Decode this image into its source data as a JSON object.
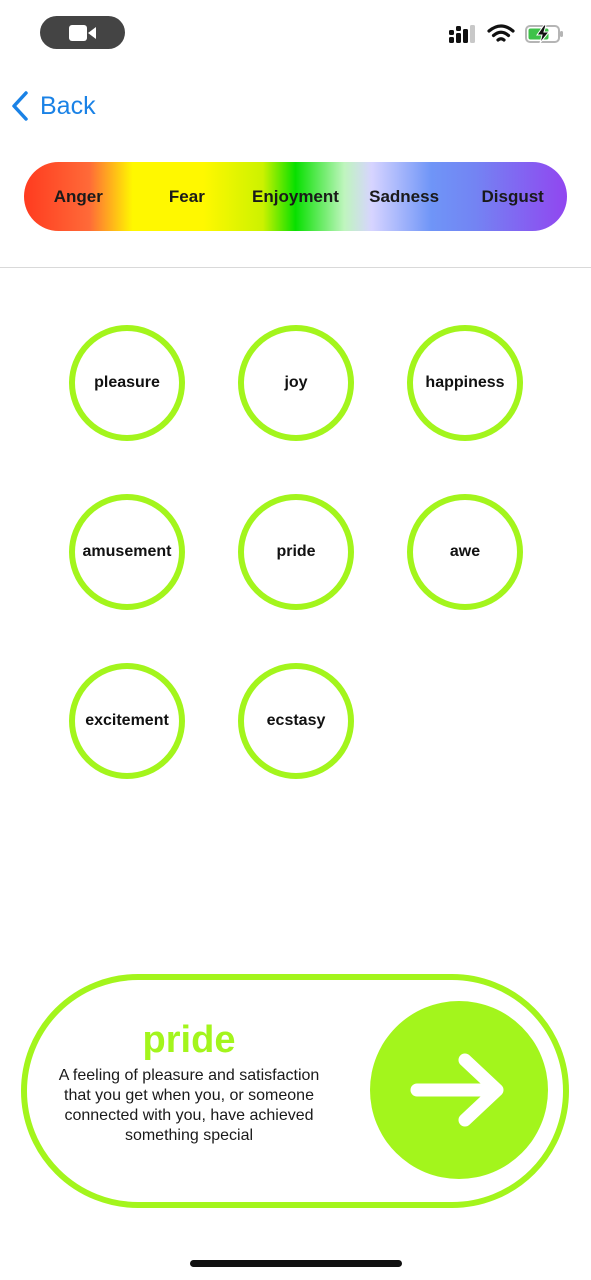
{
  "nav": {
    "back_label": "Back"
  },
  "spectrum": {
    "segments": [
      "Anger",
      "Fear",
      "Enjoyment",
      "Sadness",
      "Disgust"
    ],
    "selected": "Enjoyment"
  },
  "emotions": [
    "pleasure",
    "joy",
    "happiness",
    "amusement",
    "pride",
    "awe",
    "excitement",
    "ecstasy"
  ],
  "selected_emotion": {
    "name": "pride",
    "description": "A feeling of pleasure and satisfaction that you get when you, or someone connected with you, have achieved something special"
  },
  "colors": {
    "accent": "#a3f51c",
    "link": "#1a82e6"
  },
  "icons": {
    "camera": "video-camera-icon",
    "signal": "cellular-signal-icon",
    "wifi": "wifi-icon",
    "battery": "battery-charging-icon",
    "back": "chevron-left-icon",
    "next": "arrow-right-icon"
  }
}
